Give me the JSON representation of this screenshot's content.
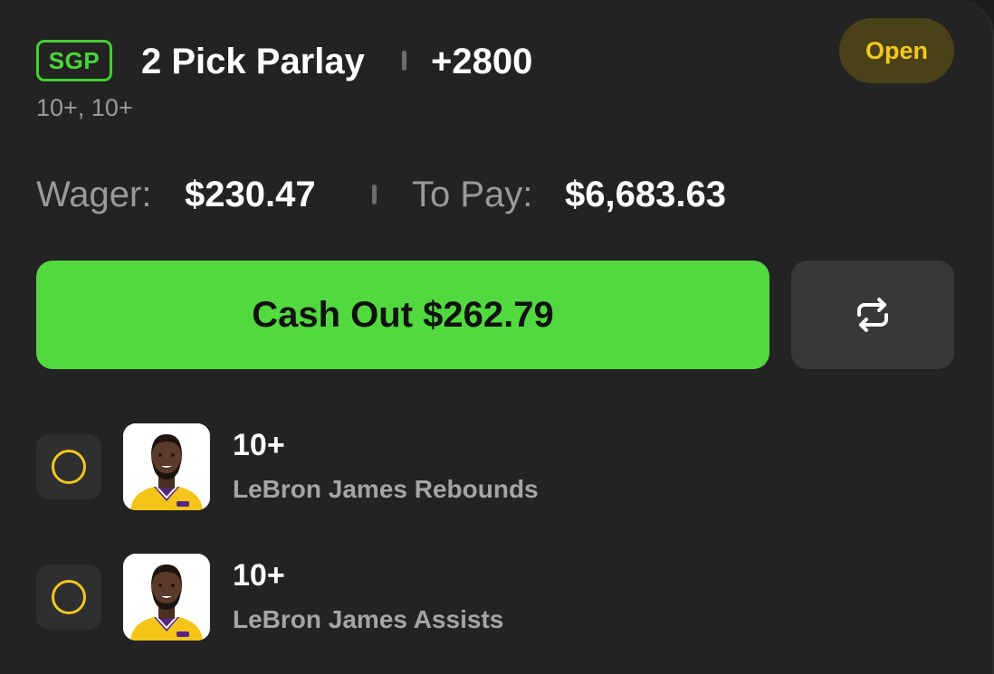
{
  "bet": {
    "badge": "SGP",
    "title": "2 Pick Parlay",
    "odds": "+2800",
    "status": "Open",
    "subtitle": "10+, 10+"
  },
  "stats": {
    "wager_label": "Wager:",
    "wager_value": "$230.47",
    "pay_label": "To Pay:",
    "pay_value": "$6,683.63"
  },
  "actions": {
    "cashout_label": "Cash Out $262.79",
    "repeat_icon": "repeat-icon"
  },
  "legs": [
    {
      "line": "10+",
      "description": "LeBron James Rebounds",
      "status_icon": "pending-circle-icon",
      "avatar": "player-headshot"
    },
    {
      "line": "10+",
      "description": "LeBron James Assists",
      "status_icon": "pending-circle-icon",
      "avatar": "player-headshot"
    }
  ],
  "colors": {
    "background": "#232323",
    "accent_green": "#52d93f",
    "badge_green": "#44cf32",
    "status_yellow": "#f2c81f",
    "status_pill_bg": "#4b4118"
  }
}
